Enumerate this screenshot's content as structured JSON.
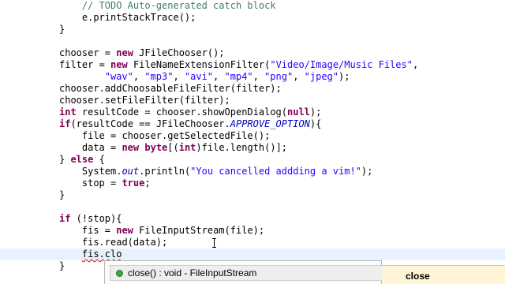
{
  "editor": {
    "lines": [
      {
        "indent": "    ",
        "tokens": [
          {
            "t": "// TODO Auto-generated catch block",
            "c": "cmt"
          }
        ]
      },
      {
        "indent": "    ",
        "tokens": [
          {
            "t": "e.printStackTrace();",
            "c": ""
          }
        ]
      },
      {
        "indent": "",
        "tokens": [
          {
            "t": "}",
            "c": ""
          }
        ]
      },
      {
        "indent": "",
        "tokens": []
      },
      {
        "indent": "",
        "tokens": [
          {
            "t": "chooser = ",
            "c": ""
          },
          {
            "t": "new",
            "c": "kw"
          },
          {
            "t": " JFileChooser();",
            "c": ""
          }
        ]
      },
      {
        "indent": "",
        "tokens": [
          {
            "t": "filter = ",
            "c": ""
          },
          {
            "t": "new",
            "c": "kw"
          },
          {
            "t": " FileNameExtensionFilter(",
            "c": ""
          },
          {
            "t": "\"Video/Image/Music Files\"",
            "c": "str"
          },
          {
            "t": ",",
            "c": ""
          }
        ]
      },
      {
        "indent": "        ",
        "tokens": [
          {
            "t": "\"wav\"",
            "c": "str"
          },
          {
            "t": ", ",
            "c": ""
          },
          {
            "t": "\"mp3\"",
            "c": "str"
          },
          {
            "t": ", ",
            "c": ""
          },
          {
            "t": "\"avi\"",
            "c": "str"
          },
          {
            "t": ", ",
            "c": ""
          },
          {
            "t": "\"mp4\"",
            "c": "str"
          },
          {
            "t": ", ",
            "c": ""
          },
          {
            "t": "\"png\"",
            "c": "str"
          },
          {
            "t": ", ",
            "c": ""
          },
          {
            "t": "\"jpeg\"",
            "c": "str"
          },
          {
            "t": ");",
            "c": ""
          }
        ]
      },
      {
        "indent": "",
        "tokens": [
          {
            "t": "chooser.addChoosableFileFilter(filter);",
            "c": ""
          }
        ]
      },
      {
        "indent": "",
        "tokens": [
          {
            "t": "chooser.setFileFilter(filter);",
            "c": ""
          }
        ]
      },
      {
        "indent": "",
        "tokens": [
          {
            "t": "int",
            "c": "kw"
          },
          {
            "t": " resultCode = chooser.showOpenDialog(",
            "c": ""
          },
          {
            "t": "null",
            "c": "kw"
          },
          {
            "t": ");",
            "c": ""
          }
        ]
      },
      {
        "indent": "",
        "tokens": [
          {
            "t": "if",
            "c": "kw"
          },
          {
            "t": "(resultCode == JFileChooser.",
            "c": ""
          },
          {
            "t": "APPROVE_OPTION",
            "c": "fld"
          },
          {
            "t": "){",
            "c": ""
          }
        ]
      },
      {
        "indent": "    ",
        "tokens": [
          {
            "t": "file = chooser.getSelectedFile();",
            "c": ""
          }
        ]
      },
      {
        "indent": "    ",
        "tokens": [
          {
            "t": "data = ",
            "c": ""
          },
          {
            "t": "new",
            "c": "kw"
          },
          {
            "t": " ",
            "c": ""
          },
          {
            "t": "byte",
            "c": "kw"
          },
          {
            "t": "[(",
            "c": ""
          },
          {
            "t": "int",
            "c": "kw"
          },
          {
            "t": ")file.length()];",
            "c": ""
          }
        ]
      },
      {
        "indent": "",
        "tokens": [
          {
            "t": "} ",
            "c": ""
          },
          {
            "t": "else",
            "c": "kw"
          },
          {
            "t": " {",
            "c": ""
          }
        ]
      },
      {
        "indent": "    ",
        "tokens": [
          {
            "t": "System.",
            "c": ""
          },
          {
            "t": "out",
            "c": "fld"
          },
          {
            "t": ".println(",
            "c": ""
          },
          {
            "t": "\"You cancelled addding a vim!\"",
            "c": "str"
          },
          {
            "t": ");",
            "c": ""
          }
        ]
      },
      {
        "indent": "    ",
        "tokens": [
          {
            "t": "stop = ",
            "c": ""
          },
          {
            "t": "true",
            "c": "kw"
          },
          {
            "t": ";",
            "c": ""
          }
        ]
      },
      {
        "indent": "",
        "tokens": [
          {
            "t": "}",
            "c": ""
          }
        ]
      },
      {
        "indent": "",
        "tokens": []
      },
      {
        "indent": "",
        "tokens": [
          {
            "t": "if",
            "c": "kw"
          },
          {
            "t": " (!stop){",
            "c": ""
          }
        ]
      },
      {
        "indent": "    ",
        "tokens": [
          {
            "t": "fis = ",
            "c": ""
          },
          {
            "t": "new",
            "c": "kw"
          },
          {
            "t": " FileInputStream(file);",
            "c": ""
          }
        ]
      },
      {
        "indent": "    ",
        "tokens": [
          {
            "t": "fis.read(data);",
            "c": ""
          }
        ]
      },
      {
        "indent": "    ",
        "current": true,
        "tokens": [
          {
            "t": "fis.clo",
            "c": "err"
          }
        ]
      },
      {
        "indent": "",
        "tokens": [
          {
            "t": "}",
            "c": ""
          }
        ]
      }
    ]
  },
  "completion": {
    "item_label": "close() : void - FileInputStream",
    "item_icon": "public-method-icon",
    "side_panel_text": "close"
  }
}
